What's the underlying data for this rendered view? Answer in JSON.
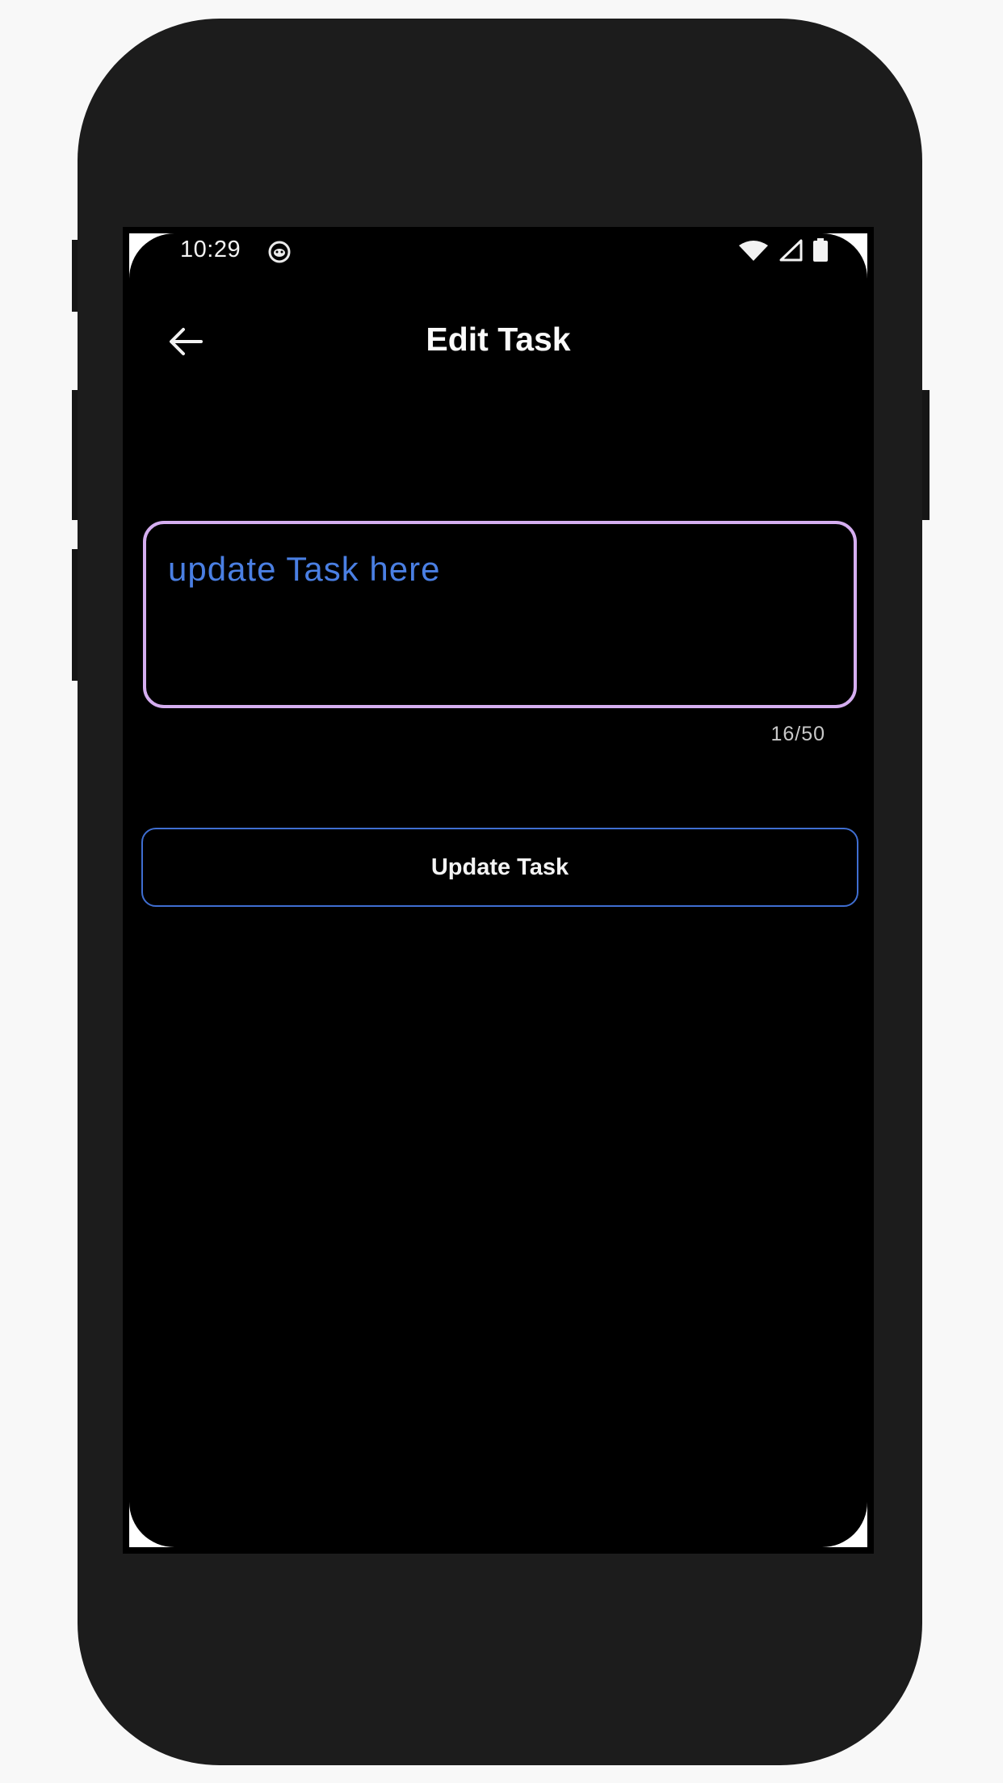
{
  "status_bar": {
    "time": "10:29",
    "notification_icon": "cat-face-icon",
    "icons": [
      "wifi-icon",
      "cell-signal-icon",
      "battery-icon"
    ]
  },
  "app_bar": {
    "title": "Edit Task",
    "back_icon": "arrow-left-icon"
  },
  "task_field": {
    "value": "update Task here",
    "counter": "16/50",
    "border_color": "#d5aef0",
    "text_color": "#4a7fe3"
  },
  "update_button": {
    "label": "Update Task",
    "border_color": "#3f6ed1"
  },
  "colors": {
    "screen_background": "#000000",
    "device_frame": "#1c1c1c"
  }
}
